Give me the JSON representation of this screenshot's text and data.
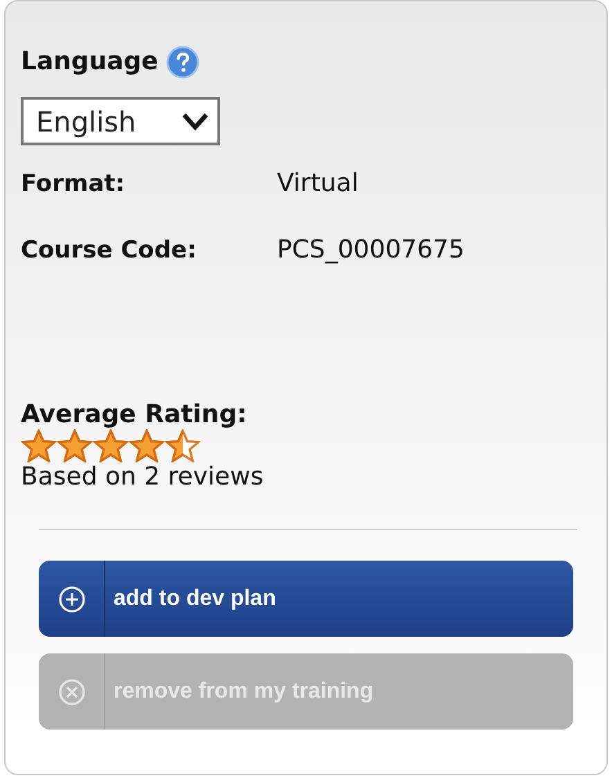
{
  "language": {
    "label": "Language",
    "value": "English"
  },
  "details": [
    {
      "label": "Format:",
      "value": "Virtual"
    },
    {
      "label": "Course Code:",
      "value": "PCS_00007675"
    }
  ],
  "rating": {
    "label": "Average Rating:",
    "stars": 4.5,
    "reviews": "Based on 2 reviews"
  },
  "actions": [
    {
      "kind": "add",
      "label": "add to dev plan",
      "disabled": false
    },
    {
      "kind": "remove",
      "label": "remove from my training",
      "disabled": true
    }
  ]
}
